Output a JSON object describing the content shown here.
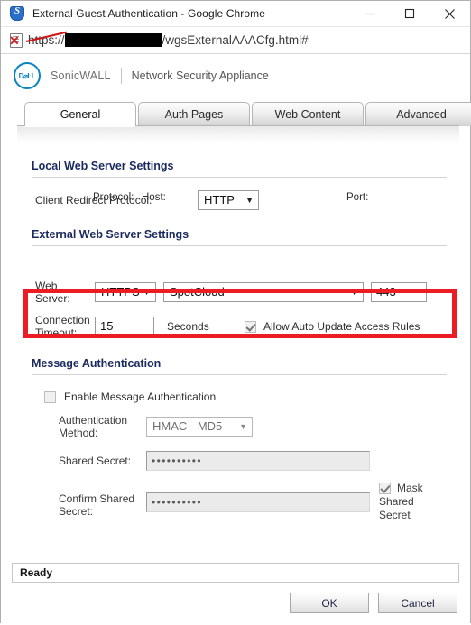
{
  "window": {
    "title": "External Guest Authentication - Google Chrome",
    "icon": "shield-icon",
    "minimize_label": "—",
    "maximize_label": "□",
    "close_label": "✕"
  },
  "urlbar": {
    "security_icon": "not-secure-page-icon",
    "scheme": "https",
    "separator": "://",
    "host_redacted": "",
    "path": "/wgsExternalAAACfg.html#"
  },
  "brand": {
    "logo_text": "D⌀LL",
    "product": "SonicWALL",
    "appliance": "Network Security Appliance"
  },
  "tabs": [
    {
      "label": "General",
      "active": true
    },
    {
      "label": "Auth Pages",
      "active": false
    },
    {
      "label": "Web Content",
      "active": false
    },
    {
      "label": "Advanced",
      "active": false
    }
  ],
  "local_web_server": {
    "heading": "Local Web Server Settings",
    "client_redirect_protocol_label": "Client Redirect Protocol:",
    "client_redirect_protocol_value": "HTTP",
    "caret": "▼"
  },
  "external_web_server": {
    "heading": "External Web Server Settings",
    "col_protocol": "Protocol:",
    "col_host": "Host:",
    "col_port": "Port:",
    "web_server_label_line1": "Web",
    "web_server_label_line2": "Server:",
    "protocol_value": "HTTPS",
    "host_value": "SpotCloud",
    "port_value": "443",
    "connection_timeout_label_line1": "Connection",
    "connection_timeout_label_line2": "Timeout:",
    "connection_timeout_value": "15",
    "seconds_label": "Seconds",
    "allow_auto_update_label": "Allow Auto Update Access Rules",
    "allow_auto_update_checked": true,
    "highlight_color": "#ec1c24"
  },
  "message_authentication": {
    "heading": "Message Authentication",
    "enable_label": "Enable Message Authentication",
    "enable_checked": false,
    "auth_method_label_line1": "Authentication",
    "auth_method_label_line2": "Method:",
    "auth_method_value": "HMAC - MD5",
    "shared_secret_label": "Shared Secret:",
    "shared_secret_value": "••••••••••",
    "confirm_secret_label_line1": "Confirm Shared",
    "confirm_secret_label_line2": "Secret:",
    "confirm_secret_value": "••••••••••",
    "mask_label_line1": "Mask",
    "mask_label_line2": "Shared",
    "mask_label_line3": "Secret",
    "mask_checked": true
  },
  "footer": {
    "status": "Ready",
    "ok_label": "OK",
    "cancel_label": "Cancel"
  }
}
